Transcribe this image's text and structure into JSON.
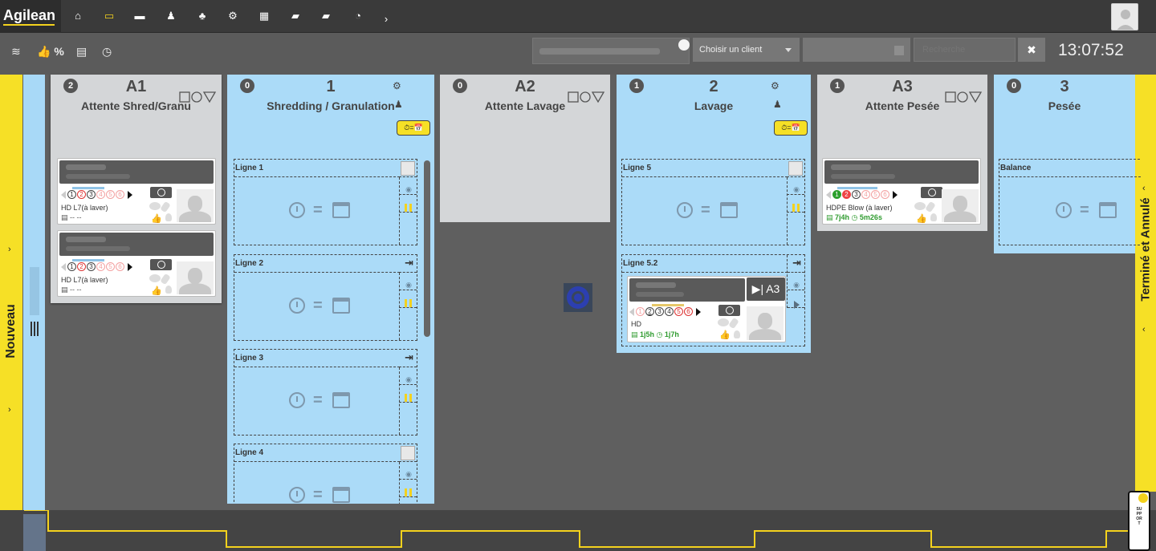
{
  "app": {
    "logo": "Agilean",
    "time": "13:07:52"
  },
  "nav": {
    "icons": [
      "home-icon",
      "monitor-icon",
      "folder-icon",
      "person-icon",
      "team-icon",
      "cogs-icon",
      "grid-icon",
      "truck-icon",
      "truck-fast-icon",
      "dashboard-icon",
      "chevron-right-icon"
    ]
  },
  "toolbar": {
    "percent_label": "%",
    "client_select": "Choisir un client",
    "search_placeholder": "Recherche",
    "clear_label": "✖"
  },
  "lanes": {
    "left_label": "Nouveau",
    "right_label": "Terminé et Annulé"
  },
  "columns": [
    {
      "badge": "2",
      "code": "A1",
      "name": "Attente Shred/Granu"
    },
    {
      "badge": "0",
      "code": "1",
      "name": "Shredding / Granulation",
      "rule": "⏱=📅"
    },
    {
      "badge": "0",
      "code": "A2",
      "name": "Attente Lavage"
    },
    {
      "badge": "1",
      "code": "2",
      "name": "Lavage",
      "rule": "⏱=📅"
    },
    {
      "badge": "1",
      "code": "A3",
      "name": "Attente Pesée"
    },
    {
      "badge": "0",
      "code": "3",
      "name": "Pesée"
    }
  ],
  "sublines": {
    "shred": [
      "Ligne 1",
      "Ligne 2",
      "Ligne 3",
      "Ligne 4"
    ],
    "lavage": [
      "Ligne 5",
      "Ligne 5.2"
    ],
    "pesee": [
      "Balance"
    ]
  },
  "cards": {
    "a1_card1": {
      "label": "HD L7(à laver)",
      "dates": "-- --",
      "steps": [
        "1",
        "2",
        "3",
        "4",
        "5",
        "6"
      ]
    },
    "a1_card2": {
      "label": "HD L7(à laver)",
      "dates": "-- --",
      "steps": [
        "1",
        "2",
        "3",
        "4",
        "5",
        "6"
      ]
    },
    "lavage_card": {
      "label": "HD",
      "date1": "1j5h",
      "date2": "1j7h",
      "tag": "A3",
      "steps": [
        "1",
        "2",
        "3",
        "4",
        "5",
        "6"
      ]
    },
    "a3_card": {
      "label": "HDPE Blow (à laver)",
      "date1": "7j4h",
      "date2": "5m26s",
      "steps": [
        "1",
        "2",
        "3",
        "4",
        "5",
        "6"
      ]
    }
  },
  "support": {
    "text": "SUPPORT"
  }
}
